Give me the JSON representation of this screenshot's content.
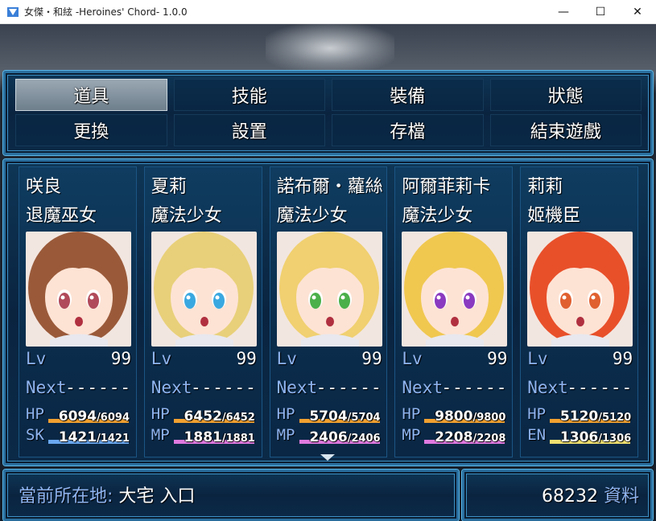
{
  "window": {
    "title": "女傑・和絃 -Heroines' Chord- 1.0.0",
    "minimize": "—",
    "maximize": "☐",
    "close": "✕"
  },
  "menu": {
    "commands": [
      {
        "label": "道具",
        "selected": true
      },
      {
        "label": "技能",
        "selected": false
      },
      {
        "label": "裝備",
        "selected": false
      },
      {
        "label": "狀態",
        "selected": false
      },
      {
        "label": "更換",
        "selected": false
      },
      {
        "label": "設置",
        "selected": false
      },
      {
        "label": "存檔",
        "selected": false
      },
      {
        "label": "結束遊戲",
        "selected": false
      }
    ]
  },
  "party": [
    {
      "name": "咲良",
      "class": "退魔巫女",
      "lv_label": "Lv",
      "lv": "99",
      "next_label": "Next",
      "next": "------",
      "hp_label": "HP",
      "hp": "6094",
      "hp_max": "/6094",
      "sp_label": "SK",
      "sp": "1421",
      "sp_max": "/1421",
      "sp_color": "#6aa8f0",
      "hair": "#9a5a3a",
      "eyes": "#b04a5a"
    },
    {
      "name": "夏莉",
      "class": "魔法少女",
      "lv_label": "Lv",
      "lv": "99",
      "next_label": "Next",
      "next": "------",
      "hp_label": "HP",
      "hp": "6452",
      "hp_max": "/6452",
      "sp_label": "MP",
      "sp": "1881",
      "sp_max": "/1881",
      "sp_color": "#e07ae0",
      "hair": "#e8d07a",
      "eyes": "#3aa8e0"
    },
    {
      "name": "諾布爾・蘿絲",
      "class": "魔法少女",
      "lv_label": "Lv",
      "lv": "99",
      "next_label": "Next",
      "next": "------",
      "hp_label": "HP",
      "hp": "5704",
      "hp_max": "/5704",
      "sp_label": "MP",
      "sp": "2406",
      "sp_max": "/2406",
      "sp_color": "#e07ae0",
      "hair": "#f0d070",
      "eyes": "#4ab04a"
    },
    {
      "name": "阿爾菲莉卡",
      "class": "魔法少女",
      "lv_label": "Lv",
      "lv": "99",
      "next_label": "Next",
      "next": "------",
      "hp_label": "HP",
      "hp": "9800",
      "hp_max": "/9800",
      "sp_label": "MP",
      "sp": "2208",
      "sp_max": "/2208",
      "sp_color": "#e07ae0",
      "hair": "#f0c850",
      "eyes": "#8a3ac0"
    },
    {
      "name": "莉莉",
      "class": "姬機臣",
      "lv_label": "Lv",
      "lv": "99",
      "next_label": "Next",
      "next": "------",
      "hp_label": "HP",
      "hp": "5120",
      "hp_max": "/5120",
      "sp_label": "EN",
      "sp": "1306",
      "sp_max": "/1306",
      "sp_color": "#f0e070",
      "hair": "#e8502a",
      "eyes": "#e06030"
    }
  ],
  "bars": {
    "hp_color": "#f0a030",
    "hp_fill": 1.0,
    "sp_fill": 1.0
  },
  "location": {
    "label": "當前所在地:",
    "value": "大宅  入口"
  },
  "gold": {
    "value": "68232",
    "unit": "資料"
  }
}
